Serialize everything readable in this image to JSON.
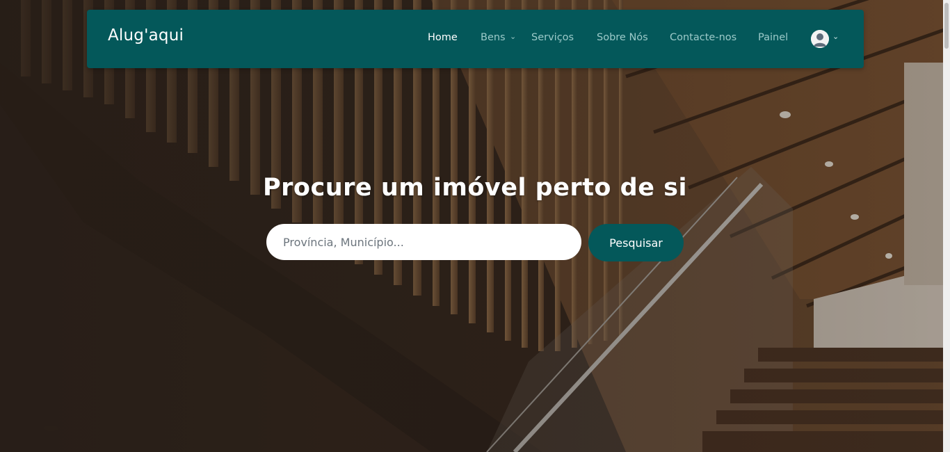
{
  "brand": {
    "name": "Alug'aqui"
  },
  "nav": {
    "items": [
      {
        "label": "Home",
        "active": true
      },
      {
        "label": "Bens",
        "has_dropdown": true
      },
      {
        "label": "Serviços"
      },
      {
        "label": "Sobre Nós"
      },
      {
        "label": "Contacte-nos"
      },
      {
        "label": "Painel"
      }
    ],
    "user_menu": {
      "icon": "user-avatar-icon",
      "caret": "chevron-down-icon"
    }
  },
  "hero": {
    "headline": "Procure um imóvel perto de si",
    "search": {
      "placeholder": "Província, Município...",
      "value": "",
      "button_label": "Pesquisar"
    },
    "background": "stairwell photo with wooden slats and glass railing"
  },
  "colors": {
    "brand": "#04585a",
    "nav_text": "#9ccac9",
    "nav_active": "#ffffff"
  }
}
